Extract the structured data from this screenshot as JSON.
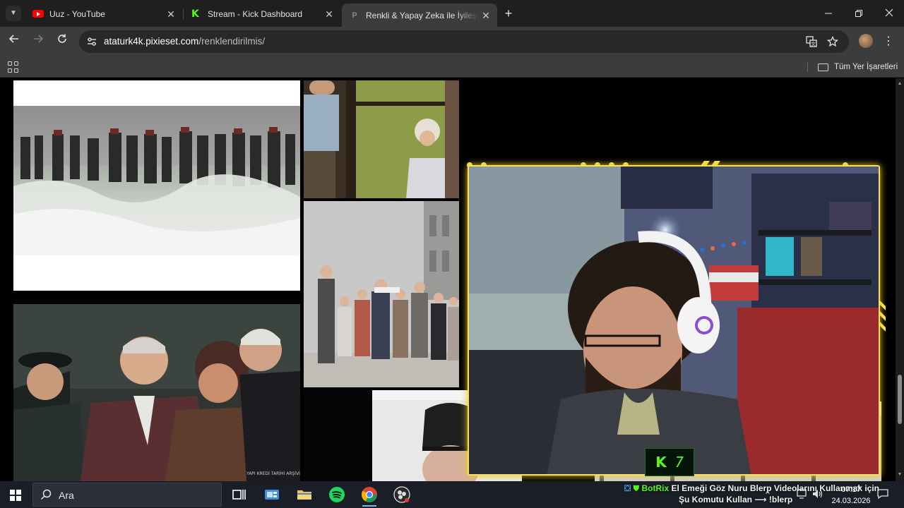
{
  "browser": {
    "tabs": [
      {
        "title": "Uuz - YouTube",
        "icon": "youtube-icon",
        "close": "✕"
      },
      {
        "title": "Stream - Kick Dashboard",
        "icon": "kick-icon",
        "close": "✕"
      },
      {
        "title": "Renkli & Yapay Zeka ile İyileştirilmiş",
        "icon": "pixieset-icon",
        "close": "✕"
      }
    ],
    "new_tab": "+",
    "address": {
      "domain": "ataturk4k.pixieset.com",
      "path": "/renklendirilmis/"
    },
    "bookmarks": {
      "all_bookmarks_label": "Tüm Yer İşaretleri"
    }
  },
  "stream_overlay": {
    "badge_letter": "K",
    "badge_number": "7"
  },
  "taskbar": {
    "search_placeholder": "Ara",
    "botrix_name": "BotRix",
    "botrix_message_line1": "El Emeği Göz Nuru Blerp Videolarını Kullanmak için",
    "botrix_message_line2": "Şu Komutu Kullan ⟶ !blerp",
    "time": "07:17",
    "date": "24.03.2026"
  },
  "colors": {
    "accent_kick": "#53fc18",
    "overlay_frame": "#f6e15a",
    "youtube_red": "#ff0000"
  }
}
